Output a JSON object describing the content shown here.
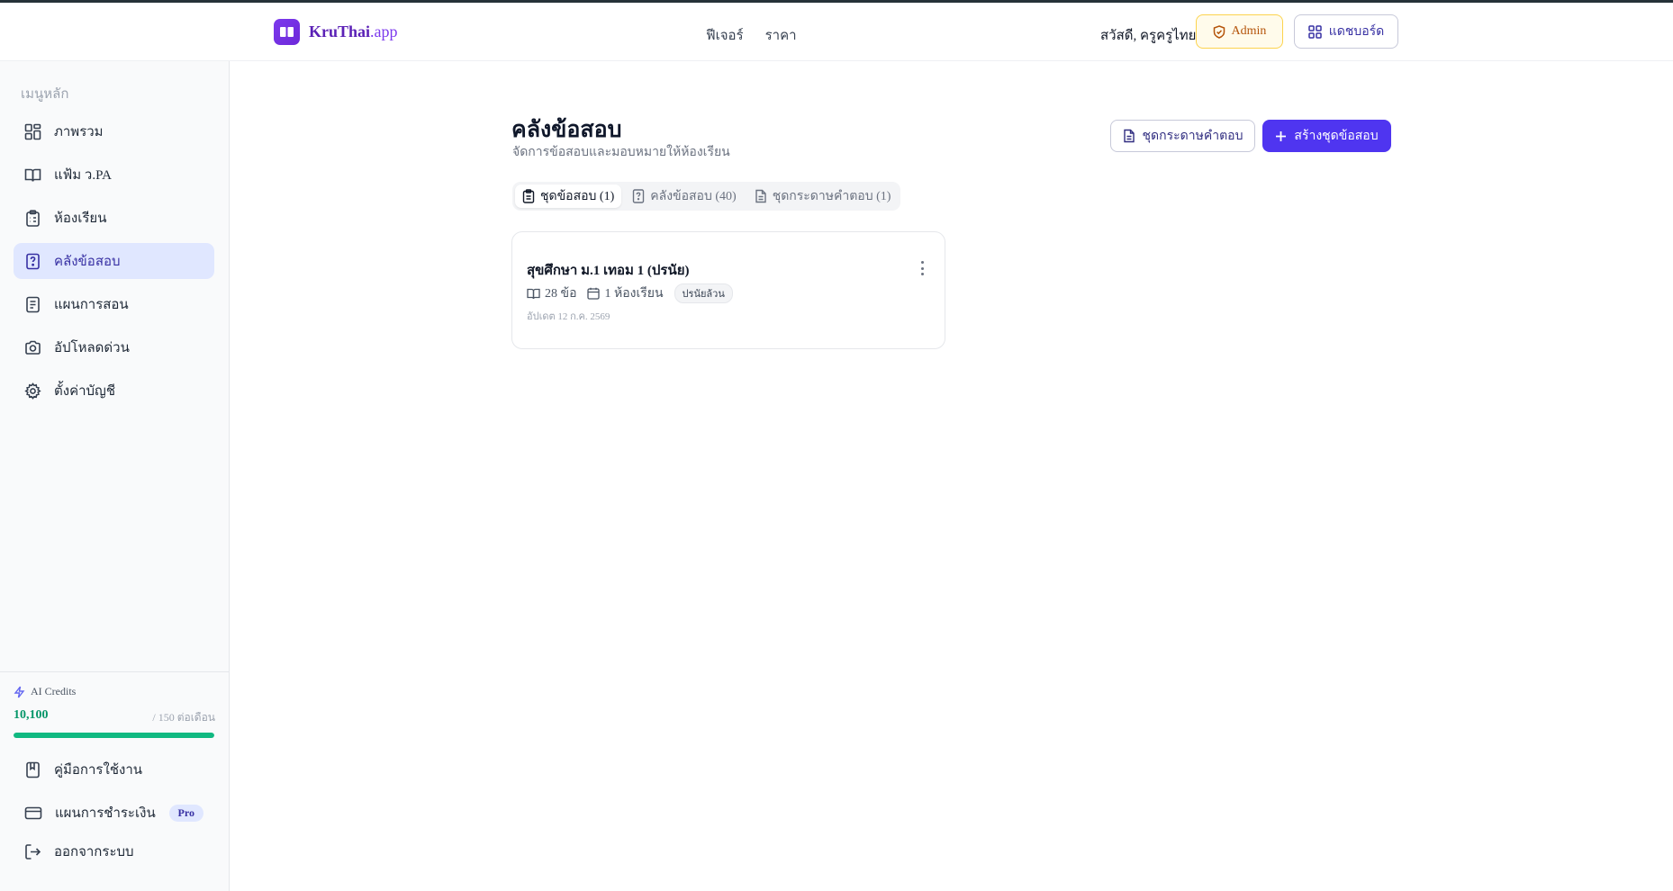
{
  "header": {
    "brand_name": "KruThai",
    "brand_domain": ".app",
    "nav": [
      "ฟีเจอร์",
      "ราคา"
    ],
    "greeting": "สวัสดี, ครูครูไทย",
    "admin_label": "Admin",
    "dashboard_label": "แดชบอร์ด"
  },
  "sidebar": {
    "heading": "เมนูหลัก",
    "items": [
      {
        "label": "ภาพรวม",
        "icon": "grid-icon"
      },
      {
        "label": "แฟ้ม ว.PA",
        "icon": "book-open-icon"
      },
      {
        "label": "ห้องเรียน",
        "icon": "clipboard-list-icon"
      },
      {
        "label": "คลังข้อสอบ",
        "icon": "file-question-icon"
      },
      {
        "label": "แผนการสอน",
        "icon": "document-icon"
      },
      {
        "label": "อัปโหลดด่วน",
        "icon": "camera-icon"
      },
      {
        "label": "ตั้งค่าบัญชี",
        "icon": "gear-icon"
      }
    ],
    "active_index": 3,
    "credits": {
      "title": "AI Credits",
      "value": "10,100",
      "quota": "/ 150 ต่อเดือน",
      "fill_fraction": 1.0
    },
    "bottom_items": [
      {
        "label": "คู่มือการใช้งาน",
        "icon": "bookmark-book-icon"
      },
      {
        "label": "แผนการชำระเงิน",
        "icon": "credit-card-icon",
        "badge": "Pro"
      }
    ],
    "logout_label": "ออกจากระบบ"
  },
  "main": {
    "title": "คลังข้อสอบ",
    "subtitle": "จัดการข้อสอบและมอบหมายให้ห้องเรียน",
    "answer_sheet_button": "ชุดกระดาษคำตอบ",
    "create_button": "สร้างชุดข้อสอบ",
    "tabs": [
      {
        "label": "ชุดข้อสอบ (1)",
        "icon": "clipboard-icon"
      },
      {
        "label": "คลังข้อสอบ (40)",
        "icon": "file-question-icon"
      },
      {
        "label": "ชุดกระดาษคำตอบ (1)",
        "icon": "document-icon"
      }
    ],
    "active_tab": 0,
    "card": {
      "title": "สุขศึกษา ม.1 เทอม 1 (ปรนัย)",
      "questions": "28 ข้อ",
      "classrooms": "1 ห้องเรียน",
      "status": "ปรนัยล้วน",
      "updated": "อัปเดต 12 ก.ค. 2569"
    }
  },
  "colors": {
    "brand": "#6d28d9",
    "primary": "#4f35f0",
    "active_bg": "#e0e7ff",
    "credits_green": "#10b981",
    "admin_amber": "#b45309"
  }
}
